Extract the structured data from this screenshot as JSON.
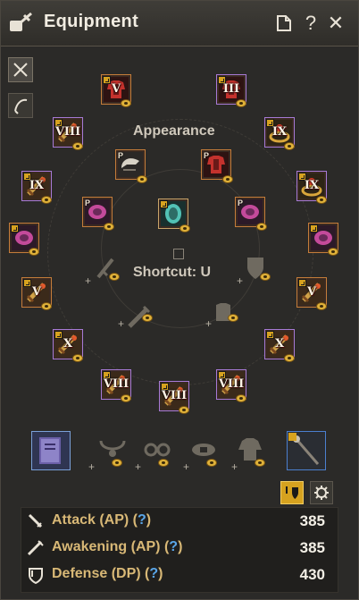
{
  "window": {
    "title": "Equipment"
  },
  "titlebar": {
    "help_label": "?",
    "close_label": "✕"
  },
  "center": {
    "appearance_label": "Appearance",
    "shortcut_label": "Shortcut: U"
  },
  "gear_slots": [
    {
      "name": "slot-top-left",
      "grade": "V",
      "border": "orange",
      "icon": "armor-icon"
    },
    {
      "name": "slot-top-right",
      "grade": "III",
      "border": "purple",
      "icon": "armor-icon"
    },
    {
      "name": "slot-upper-left-1",
      "grade": "VIII",
      "border": "purple",
      "icon": "weapon-icon"
    },
    {
      "name": "slot-upper-right-1",
      "grade": "IX",
      "border": "purple",
      "icon": "ring-icon"
    },
    {
      "name": "slot-upper-left-2",
      "grade": "IX",
      "border": "purple",
      "icon": "weapon-icon"
    },
    {
      "name": "slot-upper-right-2",
      "grade": "IX",
      "border": "purple",
      "icon": "ring-icon"
    },
    {
      "name": "slot-mid-left",
      "grade": "",
      "border": "orange",
      "icon": "gloves-icon"
    },
    {
      "name": "slot-mid-right",
      "grade": "",
      "border": "orange",
      "icon": "gloves-icon"
    },
    {
      "name": "slot-lower-left-1",
      "grade": "V",
      "border": "orange",
      "icon": "weapon-icon"
    },
    {
      "name": "slot-lower-right-1",
      "grade": "V",
      "border": "orange",
      "icon": "weapon-icon"
    },
    {
      "name": "slot-lower-left-2",
      "grade": "X",
      "border": "purple",
      "icon": "weapon-icon"
    },
    {
      "name": "slot-lower-right-2",
      "grade": "X",
      "border": "purple",
      "icon": "weapon-icon"
    },
    {
      "name": "slot-bottom-left",
      "grade": "VIII",
      "border": "purple",
      "icon": "weapon-icon"
    },
    {
      "name": "slot-bottom-center",
      "grade": "VIII",
      "border": "purple",
      "icon": "weapon-icon"
    },
    {
      "name": "slot-bottom-right",
      "grade": "VIII",
      "border": "purple",
      "icon": "weapon-icon"
    }
  ],
  "appearance_slots": [
    {
      "name": "appearance-helmet",
      "label": "P",
      "icon": "helmet-icon"
    },
    {
      "name": "appearance-armor",
      "label": "P",
      "icon": "armor-icon"
    },
    {
      "name": "appearance-gloves-left",
      "label": "P",
      "icon": "gloves-icon"
    },
    {
      "name": "appearance-shoes",
      "label": "",
      "icon": "shoes-icon"
    },
    {
      "name": "appearance-gloves-right",
      "label": "P",
      "icon": "gloves-icon"
    }
  ],
  "stats": [
    {
      "label_text": "Attack (AP) (",
      "help": "?",
      "close": ")",
      "value": "385",
      "icon": "sword-icon"
    },
    {
      "label_text": "Awakening (AP) (",
      "help": "?",
      "close": ")",
      "value": "385",
      "icon": "awakening-icon"
    },
    {
      "label_text": "Defense (DP) (",
      "help": "?",
      "close": ")",
      "value": "430",
      "icon": "shield-icon"
    }
  ],
  "colors": {
    "accent_gold": "#d6a21f",
    "purple_border": "#a77ad6",
    "orange_border": "#c57d3a",
    "help_blue": "#5aa6e8"
  }
}
